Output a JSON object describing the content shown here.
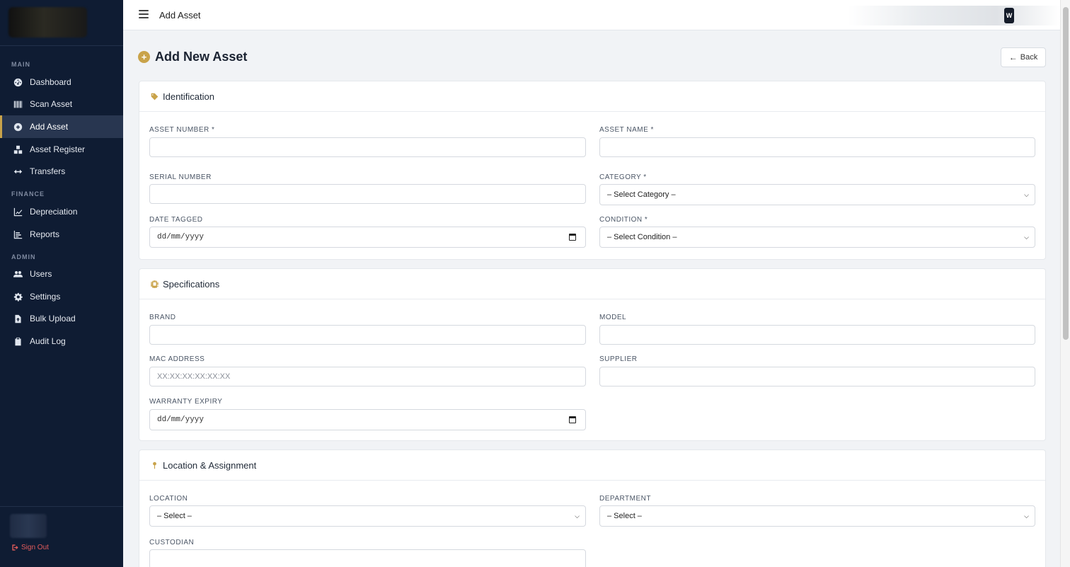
{
  "sidebar": {
    "sections": [
      {
        "label": "MAIN"
      },
      {
        "label": "FINANCE"
      },
      {
        "label": "ADMIN"
      }
    ],
    "items": [
      {
        "label": "Dashboard",
        "icon": "gauge-icon"
      },
      {
        "label": "Scan Asset",
        "icon": "barcode-icon"
      },
      {
        "label": "Add Asset",
        "icon": "plus-circle-icon",
        "active": true
      },
      {
        "label": "Asset Register",
        "icon": "boxes-icon"
      },
      {
        "label": "Transfers",
        "icon": "arrows-horizontal-icon"
      },
      {
        "label": "Depreciation",
        "icon": "line-chart-icon"
      },
      {
        "label": "Reports",
        "icon": "bar-chart-icon"
      },
      {
        "label": "Users",
        "icon": "users-icon"
      },
      {
        "label": "Settings",
        "icon": "gear-icon"
      },
      {
        "label": "Bulk Upload",
        "icon": "file-upload-icon"
      },
      {
        "label": "Audit Log",
        "icon": "clipboard-icon"
      }
    ],
    "sign_out": "Sign Out"
  },
  "topbar": {
    "title": "Add Asset",
    "avatar_initial": "W"
  },
  "page": {
    "title": "Add New Asset",
    "back_label": "Back"
  },
  "identification": {
    "title": "Identification",
    "asset_number_label": "ASSET NUMBER *",
    "asset_name_label": "ASSET NAME *",
    "serial_number_label": "SERIAL NUMBER",
    "category_label": "CATEGORY *",
    "category_value": "– Select Category –",
    "date_tagged_label": "DATE TAGGED",
    "date_tagged_value": "dd/mm/yyyy",
    "condition_label": "CONDITION *",
    "condition_value": "– Select Condition –"
  },
  "specifications": {
    "title": "Specifications",
    "brand_label": "BRAND",
    "model_label": "MODEL",
    "mac_label": "MAC ADDRESS",
    "mac_placeholder": "XX:XX:XX:XX:XX:XX",
    "supplier_label": "SUPPLIER",
    "warranty_label": "WARRANTY EXPIRY",
    "warranty_value": "dd/mm/yyyy"
  },
  "location": {
    "title": "Location & Assignment",
    "location_label": "LOCATION",
    "location_value": "– Select –",
    "department_label": "DEPARTMENT",
    "department_value": "– Select –",
    "custodian_label": "CUSTODIAN"
  },
  "colors": {
    "accent": "#c9a34a",
    "sidebar_bg": "#0f1c33",
    "sign_out": "#e25b5b"
  }
}
